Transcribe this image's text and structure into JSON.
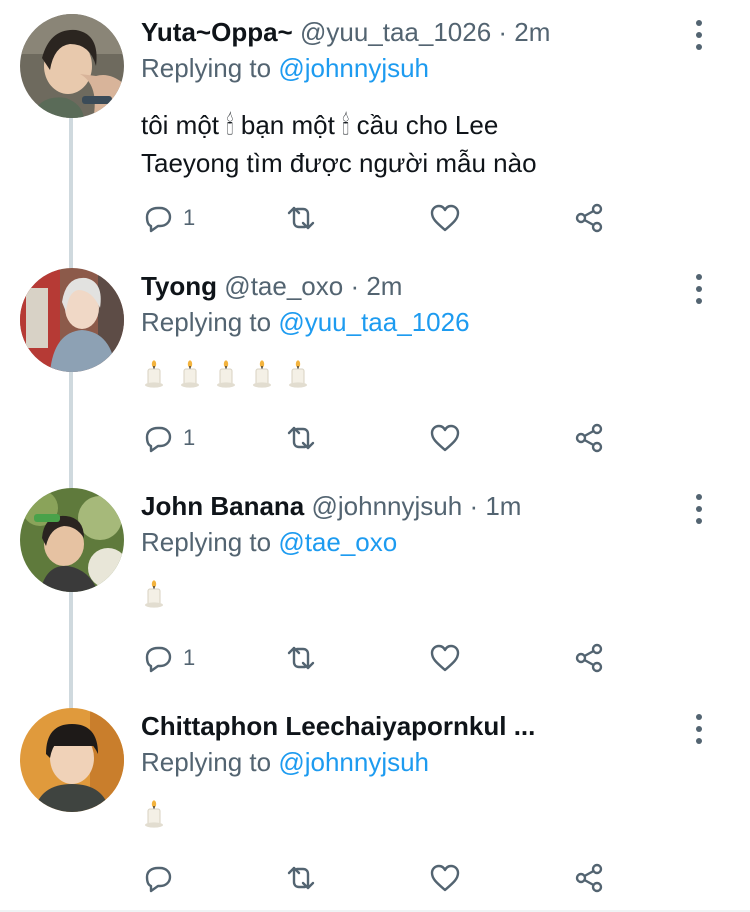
{
  "tweets": [
    {
      "name": "Yuta~Oppa~",
      "handle": "@yuu_taa_1026",
      "time": "· 2m",
      "reply_prefix": "Replying to",
      "reply_to": "@johnnyjsuh",
      "text_line1": "tôi một 🕯 bạn một 🕯 cầu cho Lee",
      "text_line2": "Taeyong tìm được người mẫu nào",
      "reply_count": "1"
    },
    {
      "name": "Tyong",
      "handle": "@tae_oxo",
      "time": "· 2m",
      "reply_prefix": "Replying to",
      "reply_to": "@yuu_taa_1026",
      "candles": 5,
      "reply_count": "1"
    },
    {
      "name": "John Banana",
      "handle": "@johnnyjsuh",
      "time": "· 1m",
      "reply_prefix": "Replying to",
      "reply_to": "@tae_oxo",
      "candles": 1,
      "reply_count": "1"
    },
    {
      "name": "Chittaphon Leechaiyapornkul ...",
      "reply_prefix": "Replying to",
      "reply_to": "@johnnyjsuh",
      "candles": 1,
      "reply_count": ""
    }
  ],
  "icons": {
    "reply": "reply-icon",
    "retweet": "retweet-icon",
    "like": "heart-icon",
    "share": "share-icon",
    "more": "more-vertical-icon"
  },
  "colors": {
    "accent": "#1d9bf0",
    "secondary_text": "#536471",
    "thread_line": "#cfd9de"
  }
}
